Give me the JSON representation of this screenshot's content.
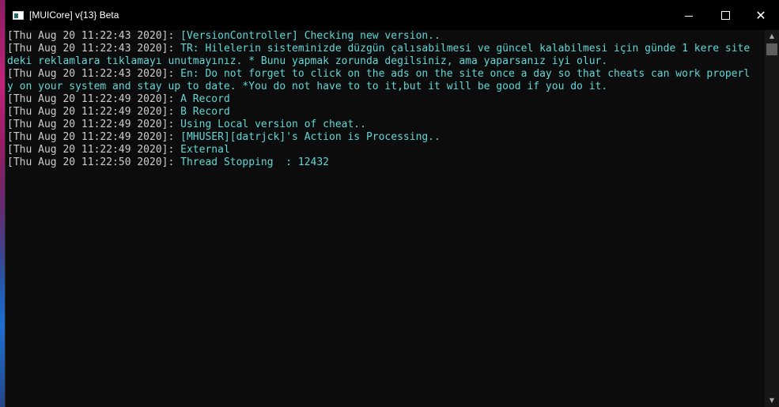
{
  "window": {
    "title": "[MUICore] v{13} Beta",
    "close_glyph": "✕",
    "icon": "console-app-icon"
  },
  "colors": {
    "timestamp": "#cccccc",
    "message": "#61d6d6",
    "background": "#0c0c0c"
  },
  "scrollbar": {
    "up_glyph": "▲",
    "down_glyph": "▼"
  },
  "log": [
    {
      "ts": "[Thu Aug 20 11:22:43 2020]: ",
      "msg": "[VersionController] Checking new version.."
    },
    {
      "ts": "[Thu Aug 20 11:22:43 2020]: ",
      "msg": "TR: Hilelerin sisteminizde düzgün çalısabilmesi ve güncel kalabilmesi için günde 1 kere site"
    },
    {
      "ts": "",
      "msg": "deki reklamlara tıklamayı unutmayınız. * Bunu yapmak zorunda degilsiniz, ama yaparsanız iyi olur."
    },
    {
      "ts": "[Thu Aug 20 11:22:43 2020]: ",
      "msg": "En: Do not forget to click on the ads on the site once a day so that cheats can work properl"
    },
    {
      "ts": "",
      "msg": "y on your system and stay up to date. *You do not have to to it,but it will be good if you do it."
    },
    {
      "ts": "[Thu Aug 20 11:22:49 2020]: ",
      "msg": "A Record"
    },
    {
      "ts": "[Thu Aug 20 11:22:49 2020]: ",
      "msg": "B Record"
    },
    {
      "ts": "[Thu Aug 20 11:22:49 2020]: ",
      "msg": "Using Local version of cheat.."
    },
    {
      "ts": "[Thu Aug 20 11:22:49 2020]: ",
      "msg": "[MHUSER][datrjck]'s Action is Processing.."
    },
    {
      "ts": "[Thu Aug 20 11:22:49 2020]: ",
      "msg": "External"
    },
    {
      "ts": "[Thu Aug 20 11:22:50 2020]: ",
      "msg": "Thread Stopping  : 12432"
    }
  ]
}
